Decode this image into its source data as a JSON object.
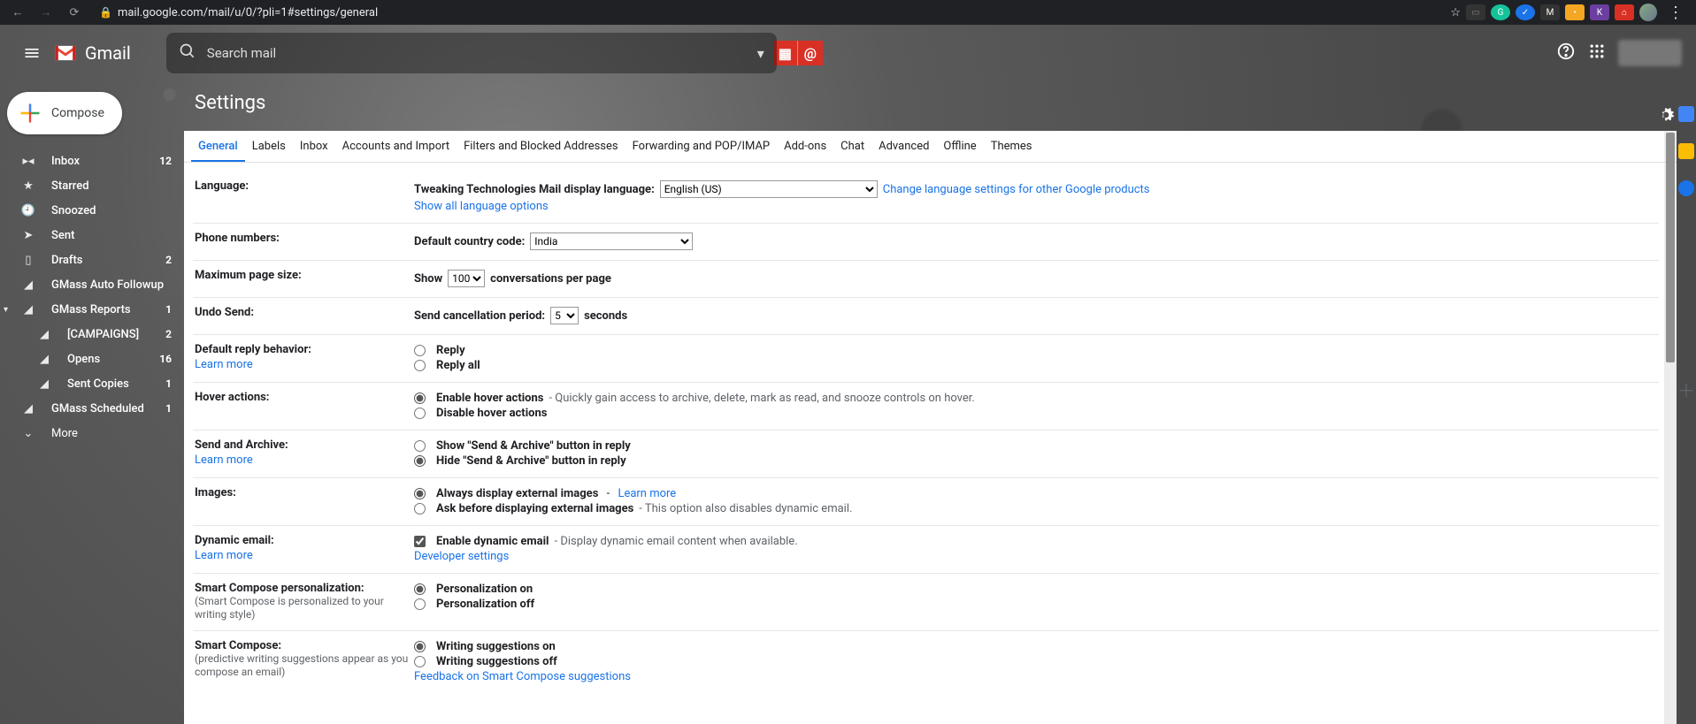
{
  "browser": {
    "url": "mail.google.com/mail/u/0/?pli=1#settings/general"
  },
  "header": {
    "brand": "Gmail",
    "search_placeholder": "Search mail"
  },
  "compose": {
    "label": "Compose"
  },
  "nav": {
    "inbox": {
      "label": "Inbox",
      "count": "12"
    },
    "starred": {
      "label": "Starred"
    },
    "snoozed": {
      "label": "Snoozed"
    },
    "sent": {
      "label": "Sent"
    },
    "drafts": {
      "label": "Drafts",
      "count": "2"
    },
    "gmass_auto": {
      "label": "GMass Auto Followup"
    },
    "gmass_reports": {
      "label": "GMass Reports",
      "count": "1"
    },
    "campaigns": {
      "label": "[CAMPAIGNS]",
      "count": "2"
    },
    "opens": {
      "label": "Opens",
      "count": "16"
    },
    "sent_copies": {
      "label": "Sent Copies",
      "count": "1"
    },
    "gmass_scheduled": {
      "label": "GMass Scheduled",
      "count": "1"
    },
    "more": {
      "label": "More"
    }
  },
  "settings": {
    "title": "Settings",
    "tabs": {
      "general": "General",
      "labels": "Labels",
      "inbox": "Inbox",
      "accounts": "Accounts and Import",
      "filters": "Filters and Blocked Addresses",
      "forwarding": "Forwarding and POP/IMAP",
      "addons": "Add-ons",
      "chat": "Chat",
      "advanced": "Advanced",
      "offline": "Offline",
      "themes": "Themes"
    },
    "rows": {
      "language": {
        "label": "Language:",
        "field_label": "Tweaking Technologies Mail display language:",
        "value": "English (US)",
        "change_link": "Change language settings for other Google products",
        "show_all": "Show all language options"
      },
      "phone": {
        "label": "Phone numbers:",
        "field_label": "Default country code:",
        "value": "India"
      },
      "pagesize": {
        "label": "Maximum page size:",
        "prefix": "Show",
        "value": "100",
        "suffix": "conversations per page"
      },
      "undo": {
        "label": "Undo Send:",
        "prefix": "Send cancellation period:",
        "value": "5",
        "suffix": "seconds"
      },
      "reply": {
        "label": "Default reply behavior:",
        "learn": "Learn more",
        "opt1": "Reply",
        "opt2": "Reply all"
      },
      "hover": {
        "label": "Hover actions:",
        "opt1": "Enable hover actions",
        "opt1_hint": " - Quickly gain access to archive, delete, mark as read, and snooze controls on hover.",
        "opt2": "Disable hover actions"
      },
      "sendarchive": {
        "label": "Send and Archive:",
        "learn": "Learn more",
        "opt1": "Show \"Send & Archive\" button in reply",
        "opt2": "Hide \"Send & Archive\" button in reply"
      },
      "images": {
        "label": "Images:",
        "opt1": "Always display external images",
        "opt1_link": "Learn more",
        "opt2": "Ask before displaying external images",
        "opt2_hint": " - This option also disables dynamic email."
      },
      "dynamic": {
        "label": "Dynamic email:",
        "learn": "Learn more",
        "opt": "Enable dynamic email",
        "hint": " - Display dynamic email content when available.",
        "dev": "Developer settings"
      },
      "smartpersonal": {
        "label": "Smart Compose personalization:",
        "sub": "(Smart Compose is personalized to your writing style)",
        "opt1": "Personalization on",
        "opt2": "Personalization off"
      },
      "smartcompose": {
        "label": "Smart Compose:",
        "sub": "(predictive writing suggestions appear as you compose an email)",
        "opt1": "Writing suggestions on",
        "opt2": "Writing suggestions off",
        "feedback": "Feedback on Smart Compose suggestions"
      }
    }
  }
}
